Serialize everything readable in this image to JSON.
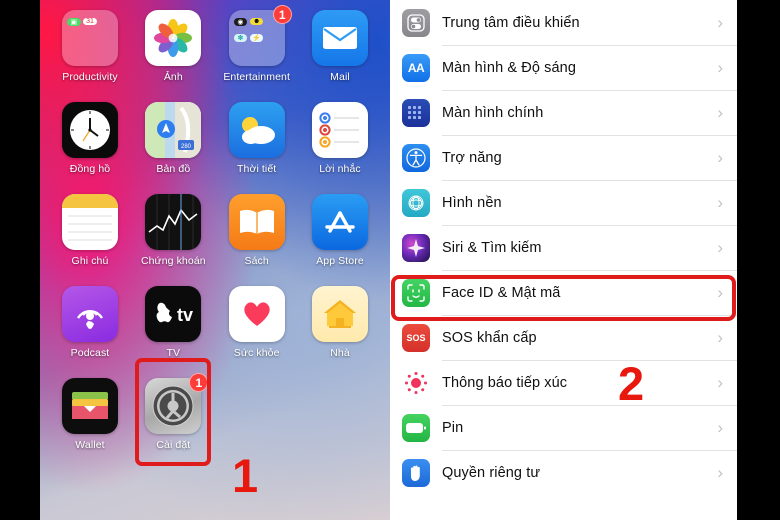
{
  "home_screen": {
    "rows": [
      [
        {
          "label": "Productivity",
          "icon": "folder-productivity-icon",
          "badge": null
        },
        {
          "label": "Ảnh",
          "icon": "photos-icon",
          "badge": null
        },
        {
          "label": "Entertainment",
          "icon": "folder-entertainment-icon",
          "badge": "1"
        },
        {
          "label": "Mail",
          "icon": "mail-icon",
          "badge": null
        }
      ],
      [
        {
          "label": "Đồng hồ",
          "icon": "clock-icon",
          "badge": null
        },
        {
          "label": "Bản đồ",
          "icon": "maps-icon",
          "badge": null
        },
        {
          "label": "Thời tiết",
          "icon": "weather-icon",
          "badge": null
        },
        {
          "label": "Lời nhắc",
          "icon": "reminders-icon",
          "badge": null
        }
      ],
      [
        {
          "label": "Ghi chú",
          "icon": "notes-icon",
          "badge": null
        },
        {
          "label": "Chứng khoán",
          "icon": "stocks-icon",
          "badge": null
        },
        {
          "label": "Sách",
          "icon": "books-icon",
          "badge": null
        },
        {
          "label": "App Store",
          "icon": "app-store-icon",
          "badge": null
        }
      ],
      [
        {
          "label": "Podcast",
          "icon": "podcasts-icon",
          "badge": null
        },
        {
          "label": "TV",
          "icon": "apple-tv-icon",
          "badge": null
        },
        {
          "label": "Sức khỏe",
          "icon": "health-icon",
          "badge": null
        },
        {
          "label": "Nhà",
          "icon": "home-app-icon",
          "badge": null
        }
      ],
      [
        {
          "label": "Wallet",
          "icon": "wallet-icon",
          "badge": null
        },
        {
          "label": "Cài đặt",
          "icon": "settings-gear-icon",
          "badge": "1"
        },
        {
          "label": "",
          "icon": "",
          "badge": null
        },
        {
          "label": "",
          "icon": "",
          "badge": null
        }
      ]
    ]
  },
  "settings": {
    "items": [
      {
        "label": "Trung tâm điều khiển",
        "icon": "control-center-icon",
        "chevron": "›"
      },
      {
        "label": "Màn hình & Độ sáng",
        "icon": "display-brightness-icon",
        "chevron": "›"
      },
      {
        "label": "Màn hình chính",
        "icon": "home-screen-icon",
        "chevron": "›"
      },
      {
        "label": "Trợ năng",
        "icon": "accessibility-icon",
        "chevron": "›"
      },
      {
        "label": "Hình nền",
        "icon": "wallpaper-icon",
        "chevron": "›"
      },
      {
        "label": "Siri & Tìm kiếm",
        "icon": "siri-icon",
        "chevron": "›"
      },
      {
        "label": "Face ID & Mật mã",
        "icon": "face-id-icon",
        "chevron": "›"
      },
      {
        "label": "SOS khẩn cấp",
        "icon": "emergency-sos-icon",
        "chevron": "›"
      },
      {
        "label": "Thông báo tiếp xúc",
        "icon": "exposure-notifications-icon",
        "chevron": "›"
      },
      {
        "label": "Pin",
        "icon": "battery-icon",
        "chevron": "›"
      },
      {
        "label": "Quyền riêng tư",
        "icon": "privacy-hand-icon",
        "chevron": "›"
      }
    ],
    "display_icon_text": "AA",
    "sos_icon_text": "SOS"
  },
  "annotations": {
    "step_one": "1",
    "step_two": "2",
    "highlight_color": "#e01b1b"
  }
}
